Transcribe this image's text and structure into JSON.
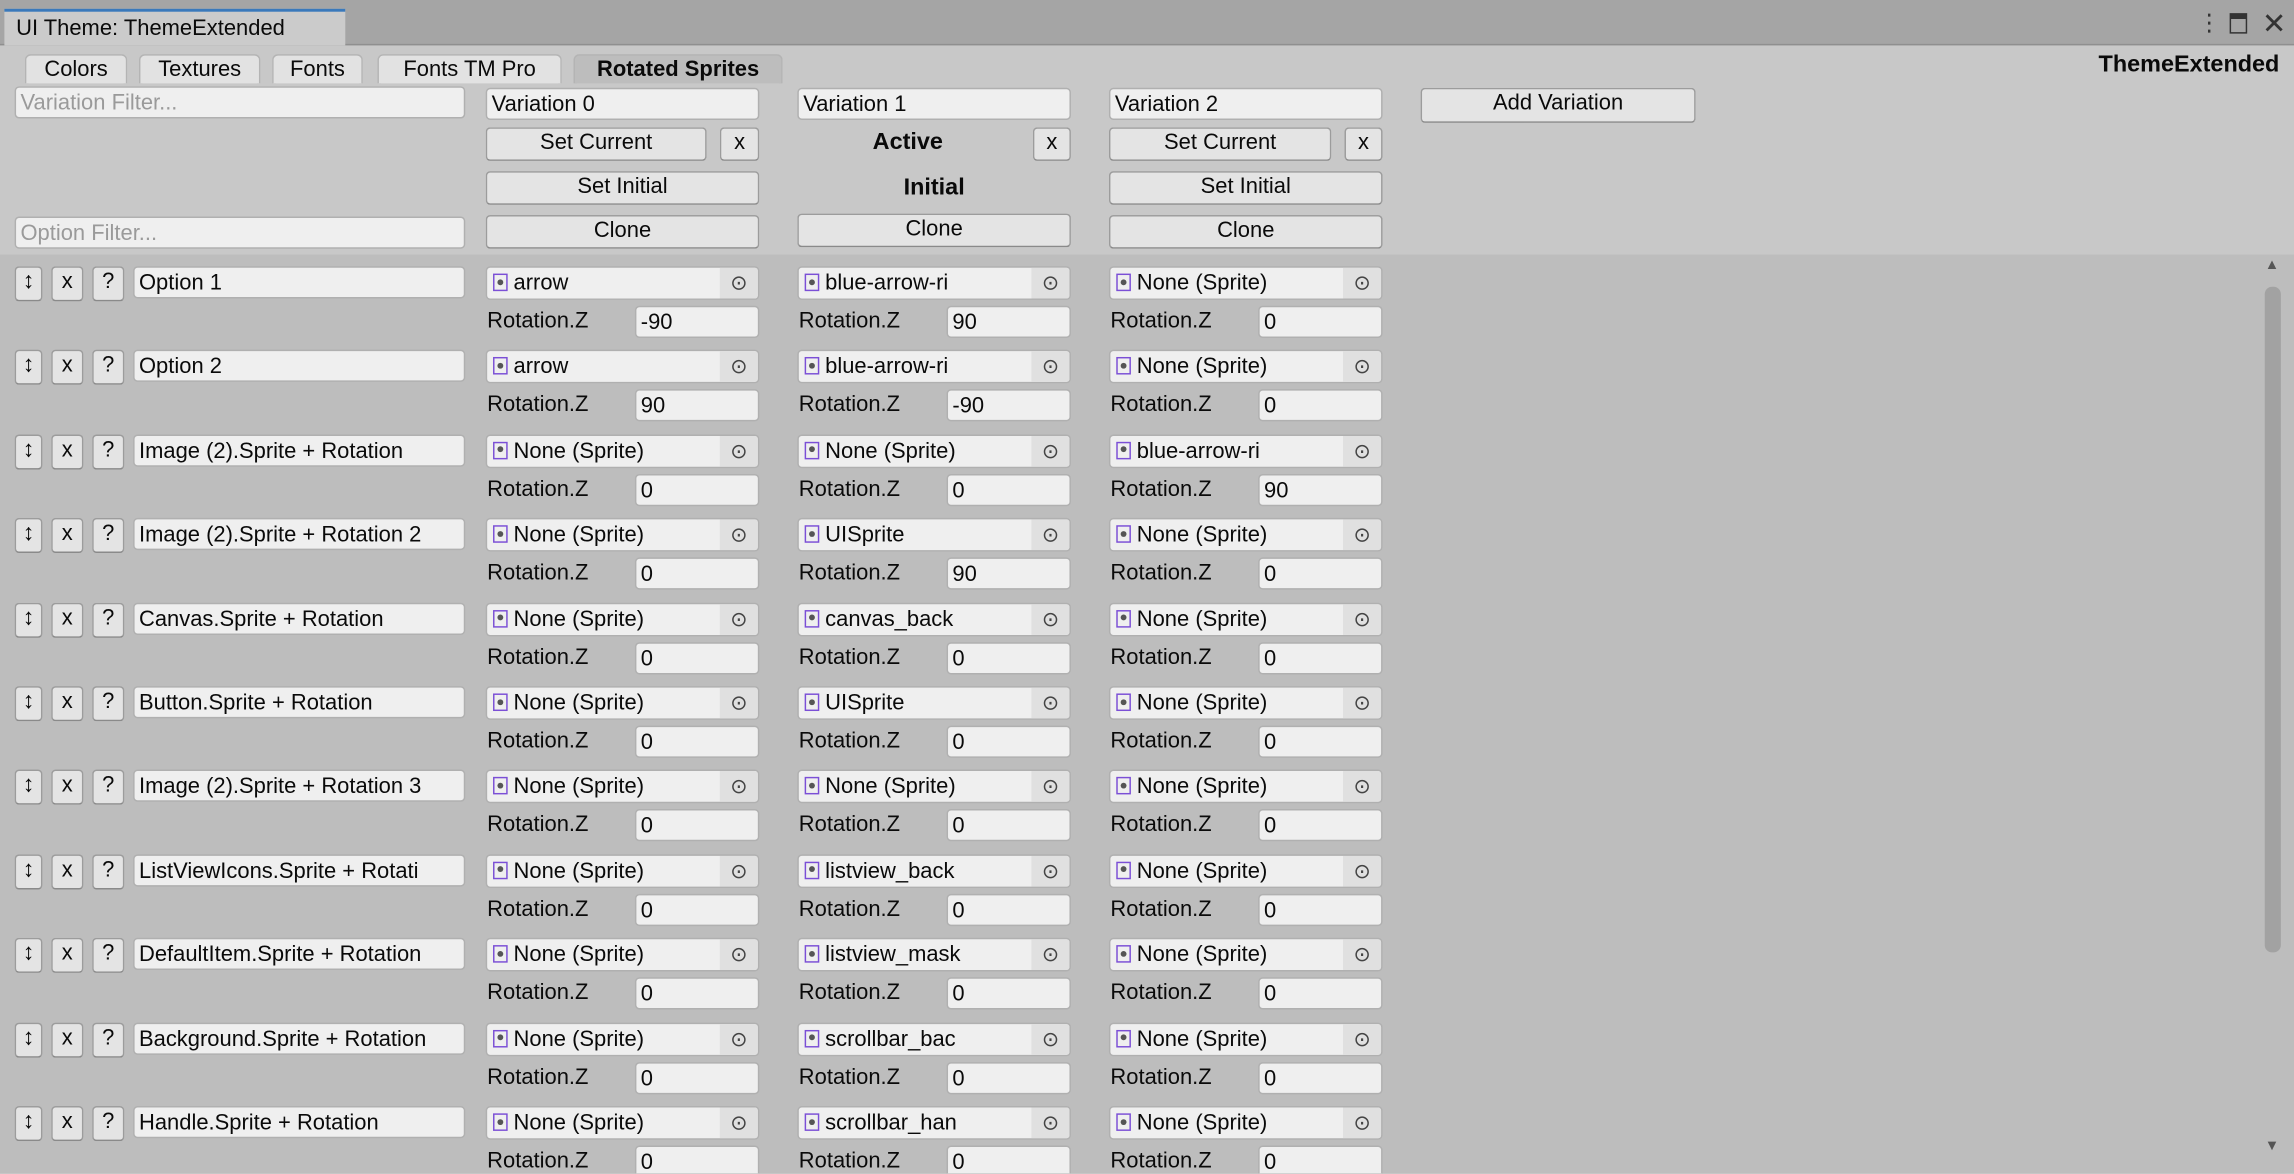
{
  "window": {
    "title": "UI Theme: ThemeExtended",
    "menu_icon": "kebab-menu-icon",
    "maximize_icon": "maximize-icon",
    "close_icon": "close-icon"
  },
  "tabs": [
    {
      "label": "Colors",
      "active": false
    },
    {
      "label": "Textures",
      "active": false
    },
    {
      "label": "Fonts",
      "active": false
    },
    {
      "label": "Fonts TM Pro",
      "active": false
    },
    {
      "label": "Rotated Sprites",
      "active": true
    }
  ],
  "theme_name": "ThemeExtended",
  "filters": {
    "variation_placeholder": "Variation Filter...",
    "option_placeholder": "Option Filter..."
  },
  "labels": {
    "set_current": "Set Current",
    "set_initial": "Set Initial",
    "clone": "Clone",
    "remove": "x",
    "active": "Active",
    "initial": "Initial",
    "add_variation": "Add Variation",
    "rotation": "Rotation.Z",
    "help": "?",
    "drag_icon": "up-down-arrow-icon",
    "picker_icon": "object-picker-icon",
    "sprite_icon": "sprite-icon"
  },
  "variations": [
    {
      "name": "Variation 0",
      "is_active": false,
      "is_initial": false
    },
    {
      "name": "Variation 1",
      "is_active": true,
      "is_initial": true
    },
    {
      "name": "Variation 2",
      "is_active": false,
      "is_initial": false
    }
  ],
  "options": [
    {
      "name": "Option 1",
      "values": [
        {
          "sprite": "arrow",
          "rotation": "-90"
        },
        {
          "sprite": "blue-arrow-ri",
          "rotation": "90"
        },
        {
          "sprite": "None (Sprite)",
          "rotation": "0"
        }
      ]
    },
    {
      "name": "Option 2",
      "values": [
        {
          "sprite": "arrow",
          "rotation": "90"
        },
        {
          "sprite": "blue-arrow-ri",
          "rotation": "-90"
        },
        {
          "sprite": "None (Sprite)",
          "rotation": "0"
        }
      ]
    },
    {
      "name": "Image (2).Sprite + Rotation",
      "values": [
        {
          "sprite": "None (Sprite)",
          "rotation": "0"
        },
        {
          "sprite": "None (Sprite)",
          "rotation": "0"
        },
        {
          "sprite": "blue-arrow-ri",
          "rotation": "90"
        }
      ]
    },
    {
      "name": "Image (2).Sprite + Rotation 2",
      "values": [
        {
          "sprite": "None (Sprite)",
          "rotation": "0"
        },
        {
          "sprite": "UISprite",
          "rotation": "90"
        },
        {
          "sprite": "None (Sprite)",
          "rotation": "0"
        }
      ]
    },
    {
      "name": "Canvas.Sprite + Rotation",
      "values": [
        {
          "sprite": "None (Sprite)",
          "rotation": "0"
        },
        {
          "sprite": "canvas_back",
          "rotation": "0"
        },
        {
          "sprite": "None (Sprite)",
          "rotation": "0"
        }
      ]
    },
    {
      "name": "Button.Sprite + Rotation",
      "values": [
        {
          "sprite": "None (Sprite)",
          "rotation": "0"
        },
        {
          "sprite": "UISprite",
          "rotation": "0"
        },
        {
          "sprite": "None (Sprite)",
          "rotation": "0"
        }
      ]
    },
    {
      "name": "Image (2).Sprite + Rotation 3",
      "values": [
        {
          "sprite": "None (Sprite)",
          "rotation": "0"
        },
        {
          "sprite": "None (Sprite)",
          "rotation": "0"
        },
        {
          "sprite": "None (Sprite)",
          "rotation": "0"
        }
      ]
    },
    {
      "name": "ListViewIcons.Sprite + Rotati",
      "values": [
        {
          "sprite": "None (Sprite)",
          "rotation": "0"
        },
        {
          "sprite": "listview_back",
          "rotation": "0"
        },
        {
          "sprite": "None (Sprite)",
          "rotation": "0"
        }
      ]
    },
    {
      "name": "DefaultItem.Sprite + Rotation",
      "values": [
        {
          "sprite": "None (Sprite)",
          "rotation": "0"
        },
        {
          "sprite": "listview_mask",
          "rotation": "0"
        },
        {
          "sprite": "None (Sprite)",
          "rotation": "0"
        }
      ]
    },
    {
      "name": "Background.Sprite + Rotation",
      "values": [
        {
          "sprite": "None (Sprite)",
          "rotation": "0"
        },
        {
          "sprite": "scrollbar_bac",
          "rotation": "0"
        },
        {
          "sprite": "None (Sprite)",
          "rotation": "0"
        }
      ]
    },
    {
      "name": "Handle.Sprite + Rotation",
      "values": [
        {
          "sprite": "None (Sprite)",
          "rotation": "0"
        },
        {
          "sprite": "scrollbar_han",
          "rotation": "0"
        },
        {
          "sprite": "None (Sprite)",
          "rotation": "0"
        }
      ]
    }
  ]
}
